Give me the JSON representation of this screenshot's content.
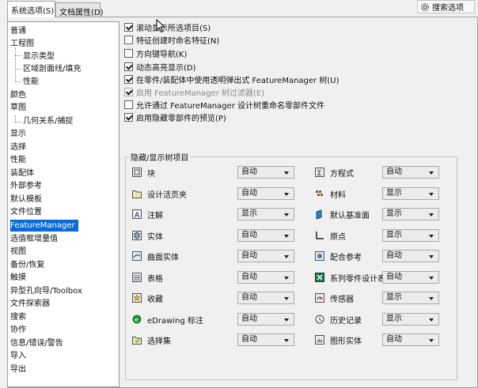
{
  "tabs": [
    "系统选项(S)",
    "文档属性(D)"
  ],
  "search_label": "搜索选项",
  "tree": [
    "普通",
    "工程图",
    "显示类型",
    "区域剖面线/填充",
    "性能",
    "颜色",
    "草图",
    "几何关系/捕捉",
    "显示",
    "选择",
    "性能",
    "装配体",
    "外部参考",
    "默认模板",
    "文件位置",
    "FeatureManager",
    "选值框增量值",
    "视图",
    "备份/恢复",
    "触摸",
    "异型孔向导/Toolbox",
    "文件探索器",
    "搜索",
    "协作",
    "信息/错误/警告",
    "导入",
    "导出"
  ],
  "options": [
    {
      "label": "滚动显示所选项目(S)",
      "checked": true,
      "disabled": false
    },
    {
      "label": "特征创建时命名特征(N)",
      "checked": false,
      "disabled": false
    },
    {
      "label": "方向键导航(K)",
      "checked": false,
      "disabled": false
    },
    {
      "label": "动态高亮显示(D)",
      "checked": true,
      "disabled": false
    },
    {
      "label": "在零件/装配体中使用透明弹出式 FeatureManager 树(U)",
      "checked": true,
      "disabled": false
    },
    {
      "label": "启用 FeatureManager 树过滤器(E)",
      "checked": true,
      "disabled": true
    },
    {
      "label": "允许通过 FeatureManager 设计树重命名零部件文件",
      "checked": false,
      "disabled": false
    },
    {
      "label": "启用隐藏零部件的预览(P)",
      "checked": true,
      "disabled": false
    }
  ],
  "group_title": "隐藏/显示树项目",
  "left_items": [
    {
      "label": "块",
      "value": "自动",
      "icon": "block-icon"
    },
    {
      "label": "设计活页夹",
      "value": "自动",
      "icon": "design-binder-icon"
    },
    {
      "label": "注解",
      "value": "显示",
      "icon": "annotation-icon"
    },
    {
      "label": "实体",
      "value": "自动",
      "icon": "solid-body-icon"
    },
    {
      "label": "曲面实体",
      "value": "自动",
      "icon": "surface-body-icon"
    },
    {
      "label": "表格",
      "value": "自动",
      "icon": "table-icon"
    },
    {
      "label": "收藏",
      "value": "自动",
      "icon": "favorites-icon"
    },
    {
      "label": "eDrawing 标注",
      "value": "自动",
      "icon": "edrawing-icon"
    },
    {
      "label": "选择集",
      "value": "自动",
      "icon": "selection-set-icon"
    }
  ],
  "right_items": [
    {
      "label": "方程式",
      "value": "自动",
      "icon": "equation-icon"
    },
    {
      "label": "材料",
      "value": "显示",
      "icon": "material-icon"
    },
    {
      "label": "默认基准面",
      "value": "显示",
      "icon": "plane-icon"
    },
    {
      "label": "原点",
      "value": "显示",
      "icon": "origin-icon"
    },
    {
      "label": "配合参考",
      "value": "自动",
      "icon": "mate-reference-icon"
    },
    {
      "label": "系列零件设计表",
      "value": "自动",
      "icon": "design-table-icon"
    },
    {
      "label": "传感器",
      "value": "显示",
      "icon": "sensor-icon"
    },
    {
      "label": "历史记录",
      "value": "显示",
      "icon": "history-icon"
    },
    {
      "label": "图形实体",
      "value": "自动",
      "icon": "graphics-body-icon"
    }
  ],
  "colors": {
    "selected": "#0a6ad6"
  }
}
